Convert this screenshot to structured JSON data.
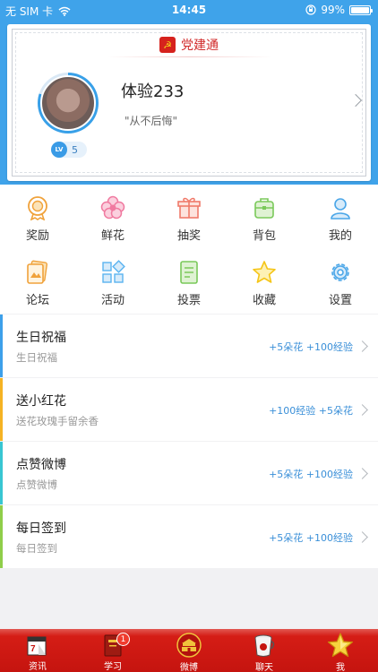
{
  "status_bar": {
    "carrier": "无 SIM 卡",
    "time": "14:45",
    "battery": "99%",
    "battery_level": 0.99
  },
  "card": {
    "app_name": "党建通",
    "username": "体验233",
    "motto": "\"从不后悔\"",
    "level_badge": "LV",
    "level": "5"
  },
  "grid": [
    {
      "label": "奖励",
      "icon": "medal-icon",
      "color": "#f0a23b"
    },
    {
      "label": "鲜花",
      "icon": "flower-icon",
      "color": "#f07aa0"
    },
    {
      "label": "抽奖",
      "icon": "gift-icon",
      "color": "#f07a6a"
    },
    {
      "label": "背包",
      "icon": "backpack-icon",
      "color": "#7ac95a"
    },
    {
      "label": "我的",
      "icon": "person-icon",
      "color": "#4aa6e8"
    },
    {
      "label": "论坛",
      "icon": "forum-icon",
      "color": "#f0a23b"
    },
    {
      "label": "活动",
      "icon": "activity-icon",
      "color": "#5ab3f0"
    },
    {
      "label": "投票",
      "icon": "vote-icon",
      "color": "#7ac95a"
    },
    {
      "label": "收藏",
      "icon": "star-icon",
      "color": "#f5c518"
    },
    {
      "label": "设置",
      "icon": "gear-icon",
      "color": "#4aa6e8"
    }
  ],
  "tasks": [
    {
      "title": "生日祝福",
      "subtitle": "生日祝福",
      "reward": "+5朵花 +100经验",
      "color": "#3da0ea"
    },
    {
      "title": "送小红花",
      "subtitle": "送花玫瑰手留余香",
      "reward": "+100经验 +5朵花",
      "color": "#f5b324"
    },
    {
      "title": "点赞微博",
      "subtitle": "点赞微博",
      "reward": "+5朵花 +100经验",
      "color": "#38c6d2"
    },
    {
      "title": "每日签到",
      "subtitle": "每日签到",
      "reward": "+5朵花 +100经验",
      "color": "#8fce4a"
    }
  ],
  "tabs": [
    {
      "label": "资讯",
      "icon": "calendar-icon"
    },
    {
      "label": "学习",
      "icon": "book-icon",
      "badge": "1"
    },
    {
      "label": "微博",
      "icon": "tiananmen-icon"
    },
    {
      "label": "聊天",
      "icon": "chat-cup-icon"
    },
    {
      "label": "我",
      "icon": "star-icon"
    }
  ]
}
